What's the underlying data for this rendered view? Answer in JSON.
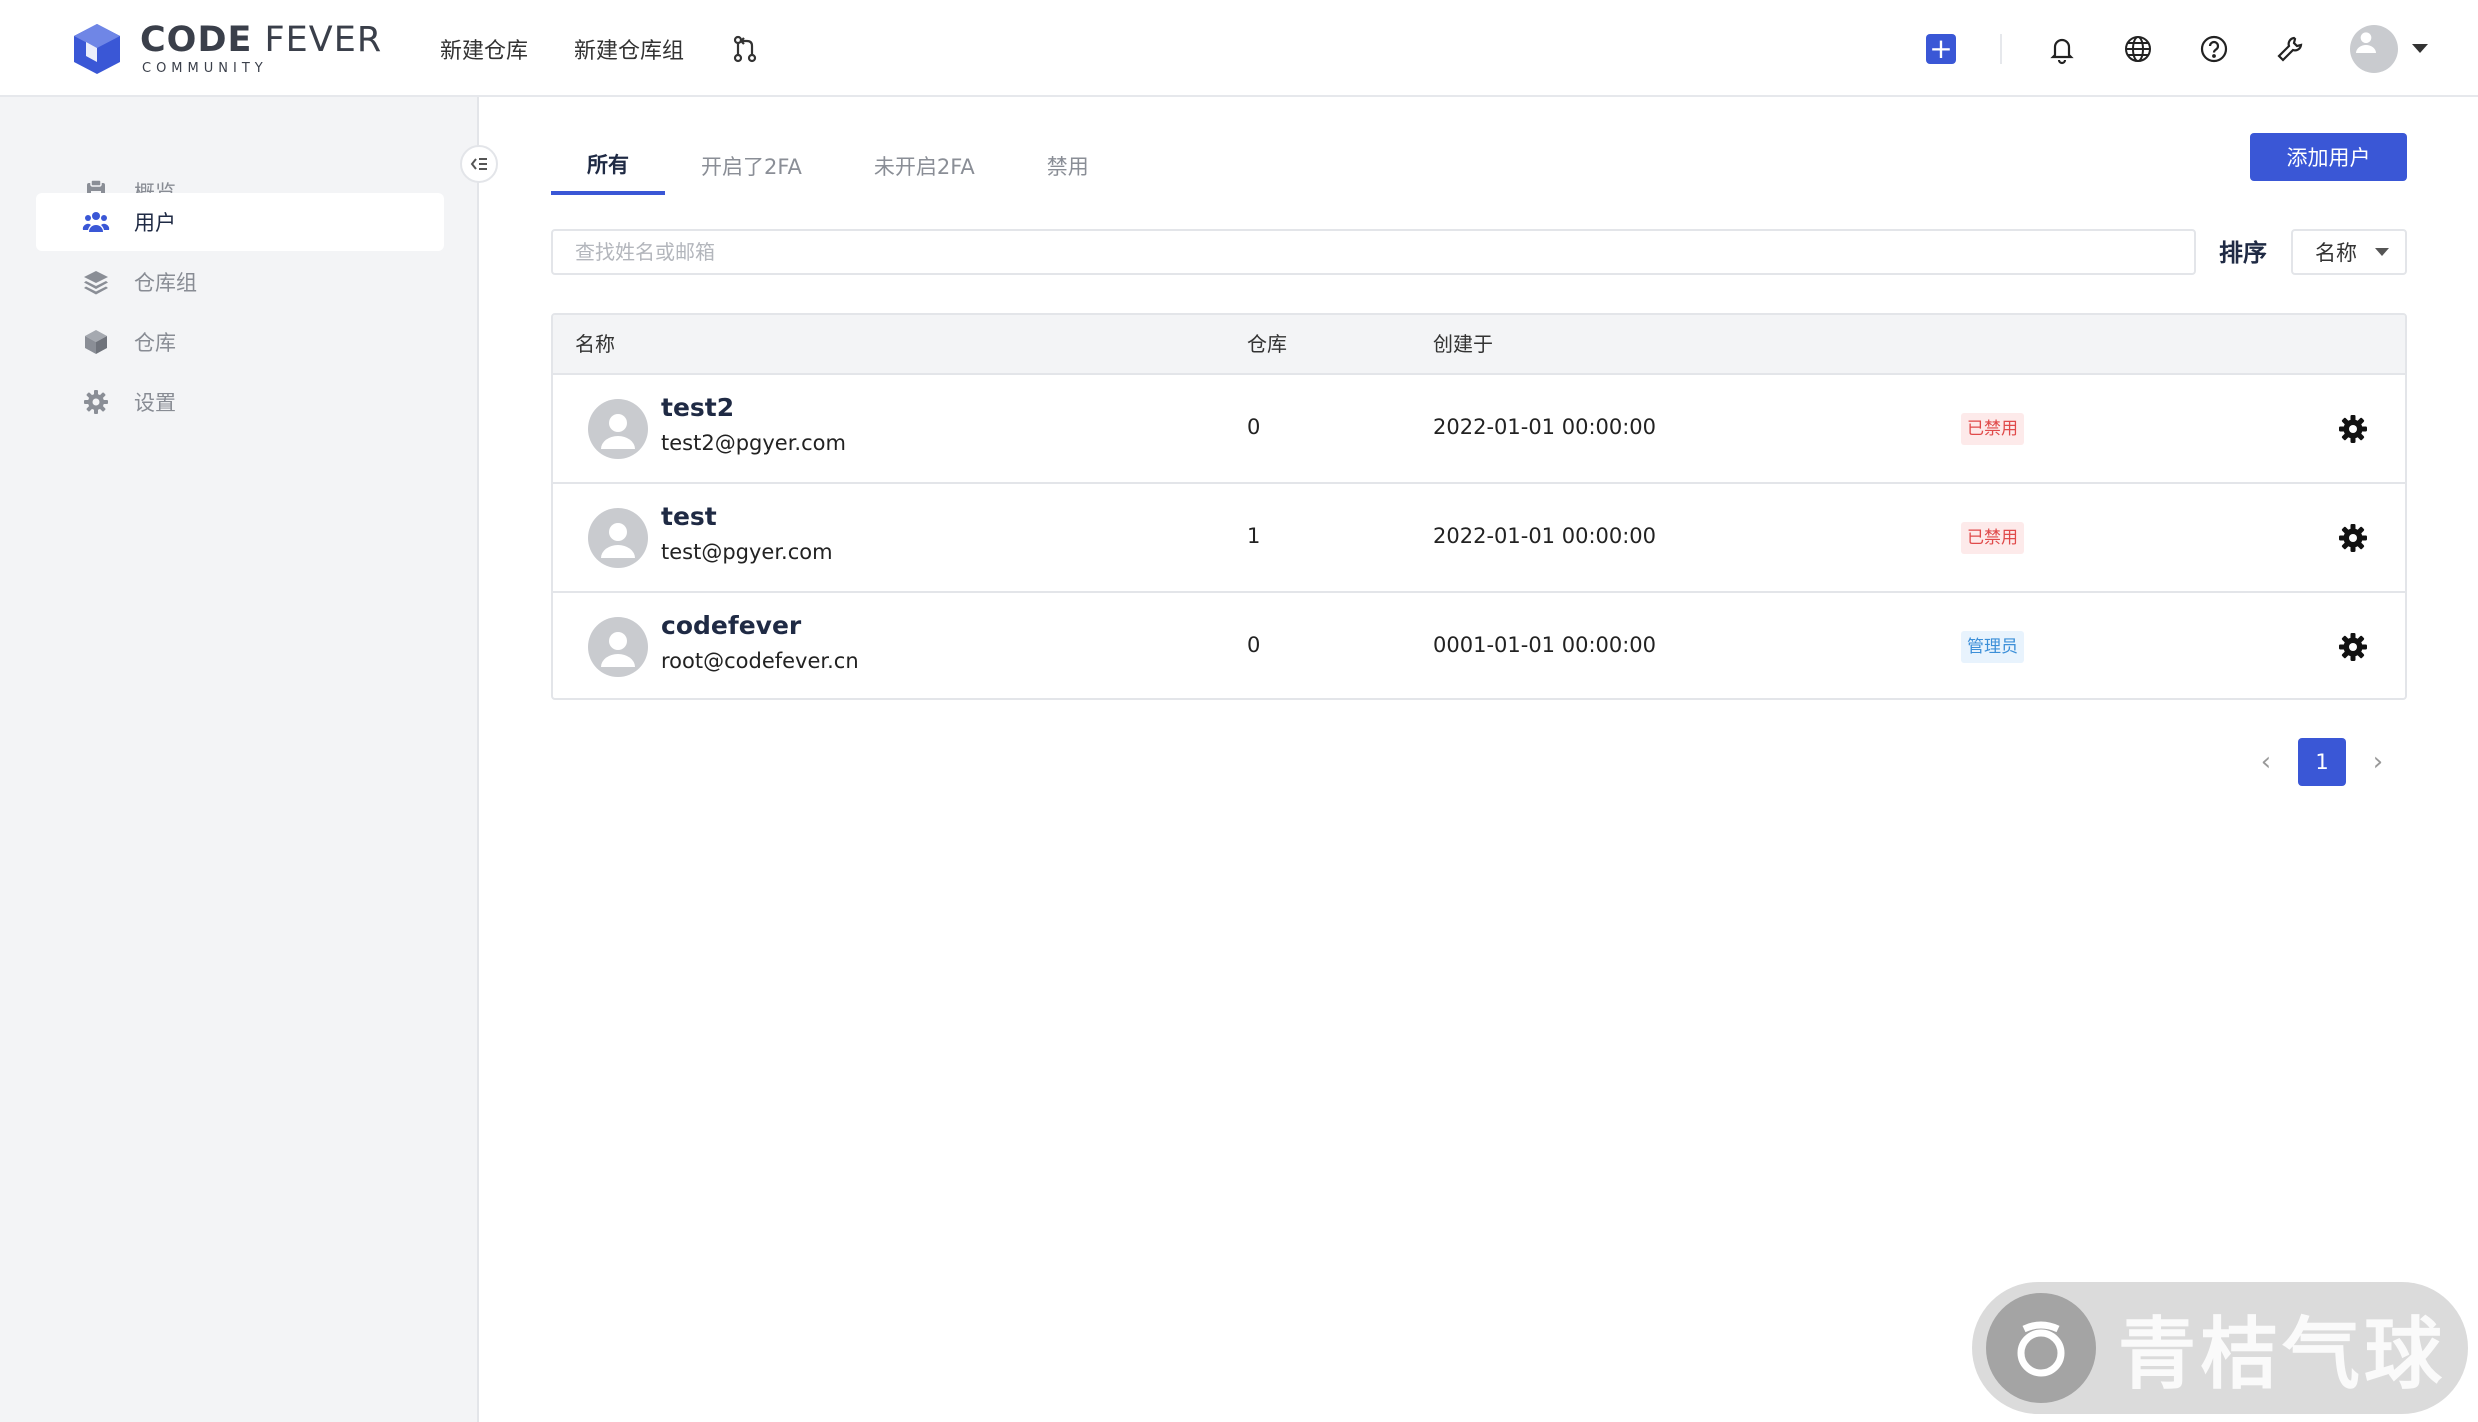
{
  "brand": {
    "title_bold": "CODE",
    "title_light": " FEVER",
    "subtitle": "COMMUNITY",
    "color": "#3a57d6"
  },
  "topnav": {
    "new_repo": "新建仓库",
    "new_repo_group": "新建仓库组"
  },
  "icons": {
    "merge_request": "git-merge-icon",
    "create": "plus-square-icon",
    "notify": "bell-icon",
    "language": "globe-icon",
    "help": "question-circle-icon",
    "admin": "wrench-icon",
    "user": "avatar-icon"
  },
  "sidebar": {
    "items": [
      {
        "label": "概览",
        "icon": "clipboard-icon"
      },
      {
        "label": "用户",
        "icon": "users-icon"
      },
      {
        "label": "仓库组",
        "icon": "layers-icon"
      },
      {
        "label": "仓库",
        "icon": "cube-icon"
      },
      {
        "label": "设置",
        "icon": "gear-icon"
      }
    ],
    "active_index": 1
  },
  "tabs": [
    "所有",
    "开启了2FA",
    "未开启2FA",
    "禁用"
  ],
  "add_user": "添加用户",
  "search": {
    "placeholder": "查找姓名或邮箱",
    "value": ""
  },
  "sort": {
    "label": "排序",
    "selected": "名称"
  },
  "table": {
    "columns": [
      "名称",
      "仓库",
      "创建于"
    ],
    "rows": [
      {
        "name": "test2",
        "email": "test2@pgyer.com",
        "repos": "0",
        "created": "2022-01-01 00:00:00",
        "badge": "已禁用",
        "badge_type": "disabled"
      },
      {
        "name": "test",
        "email": "test@pgyer.com",
        "repos": "1",
        "created": "2022-01-01 00:00:00",
        "badge": "已禁用",
        "badge_type": "disabled"
      },
      {
        "name": "codefever",
        "email": "root@codefever.cn",
        "repos": "0",
        "created": "0001-01-01 00:00:00",
        "badge": "管理员",
        "badge_type": "admin"
      }
    ]
  },
  "pagination": {
    "prev": "‹",
    "current": "1",
    "next": "›"
  },
  "watermark": {
    "text": "青桔气球"
  }
}
